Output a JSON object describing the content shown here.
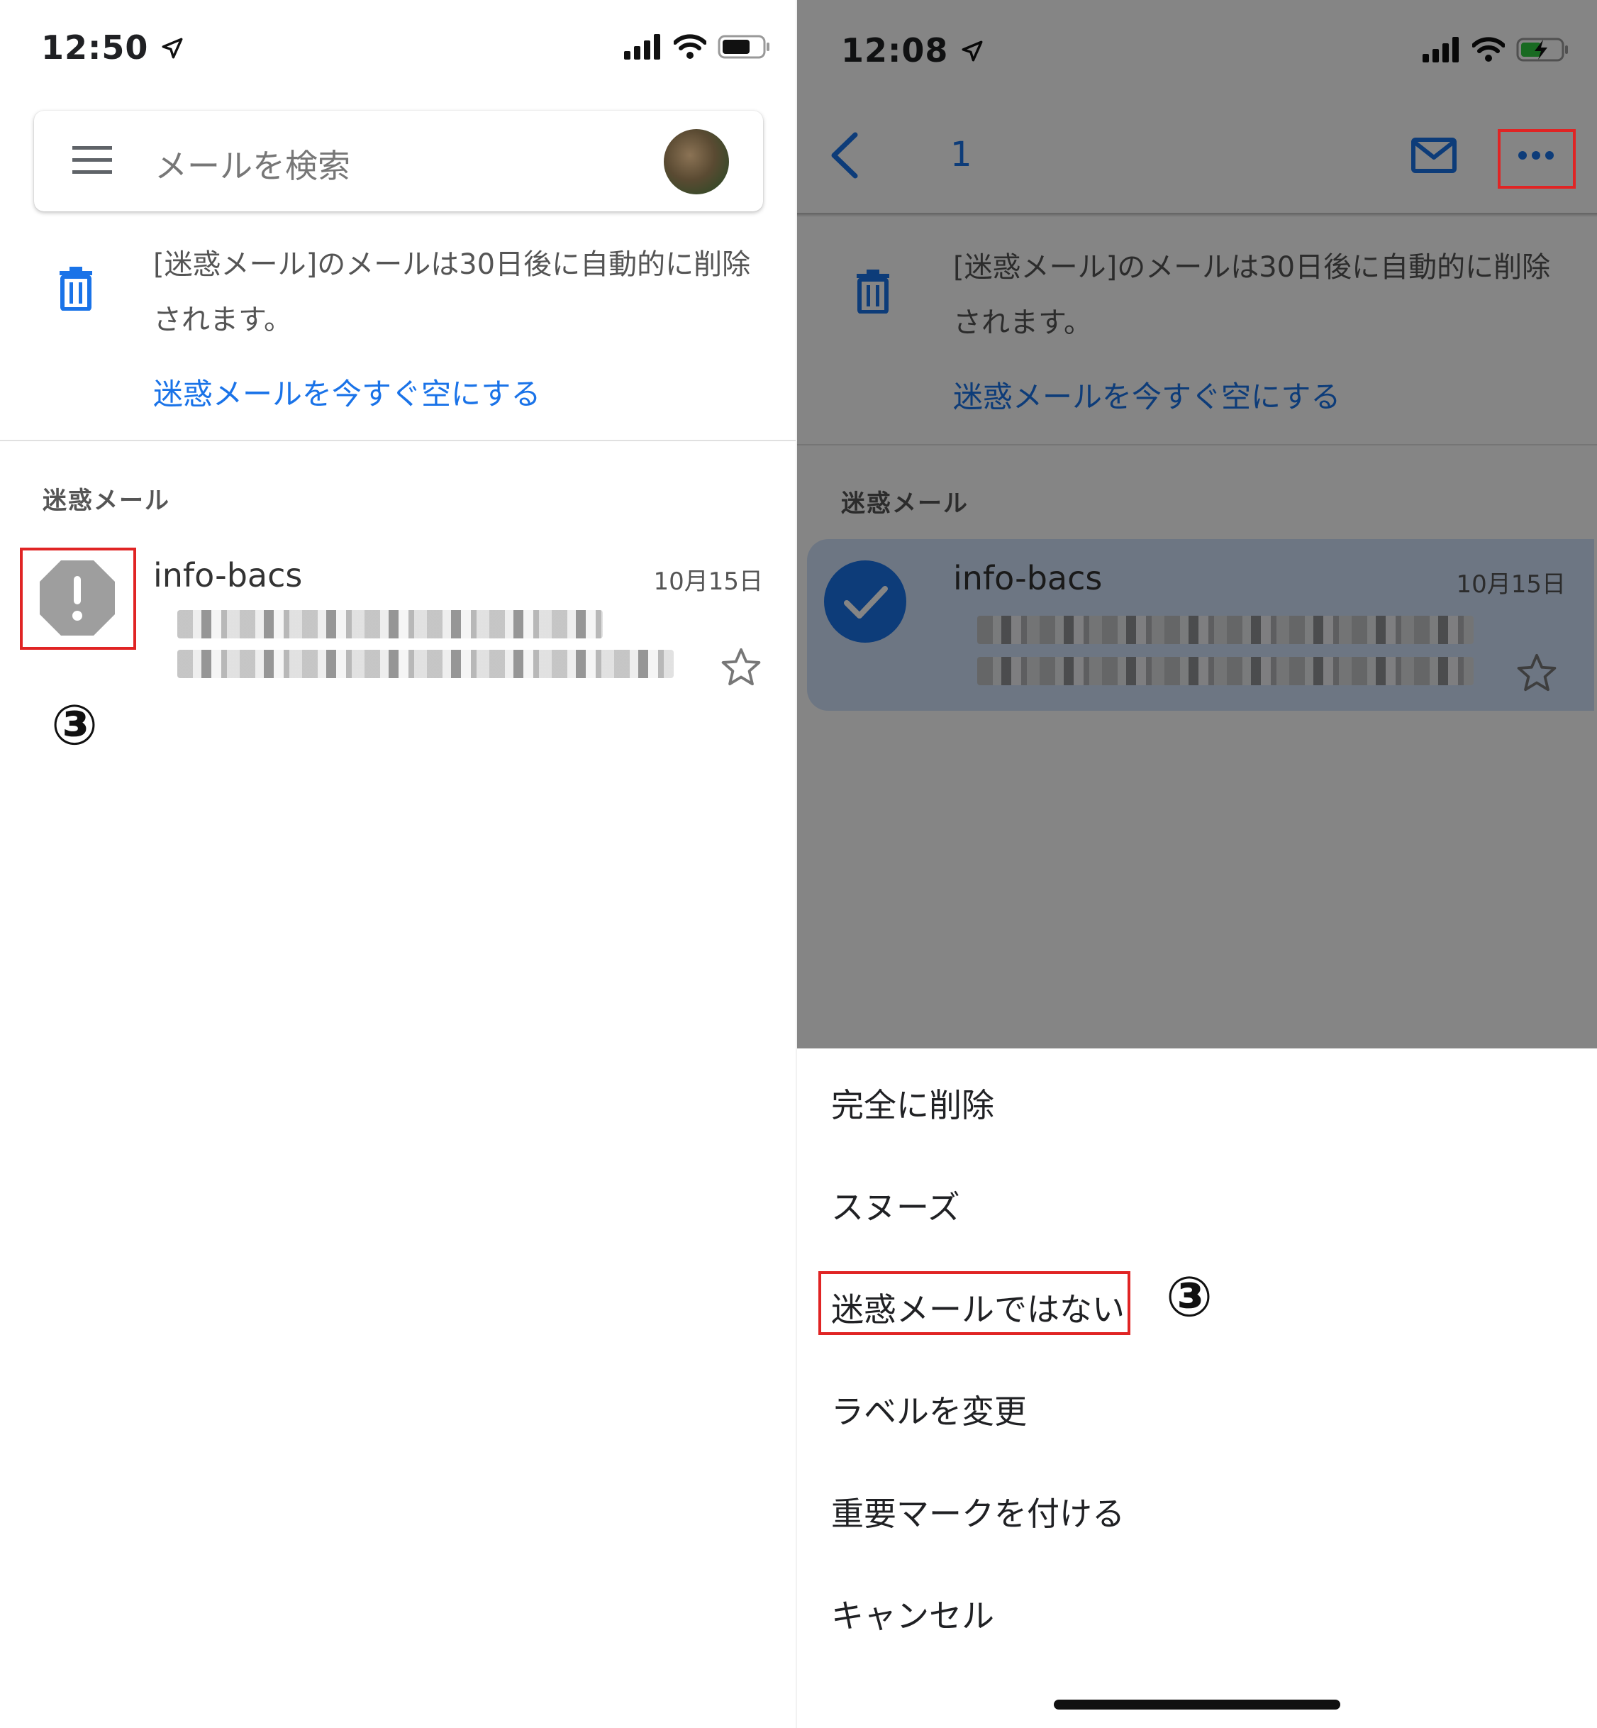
{
  "left": {
    "status_time": "12:50",
    "search_placeholder": "メールを検索",
    "notice_line1": "[迷惑メール]のメールは30日後に自動的に削除",
    "notice_line2": "されます。",
    "notice_link": "迷惑メールを今すぐ空にする",
    "section_label": "迷惑メール",
    "email": {
      "sender": "info-bacs",
      "date": "10月15日"
    },
    "step_marker": "③"
  },
  "right": {
    "status_time": "12:08",
    "selected_count": "1",
    "notice_line1": "[迷惑メール]のメールは30日後に自動的に削除",
    "notice_line2": "されます。",
    "notice_link": "迷惑メールを今すぐ空にする",
    "section_label": "迷惑メール",
    "email": {
      "sender": "info-bacs",
      "date": "10月15日"
    },
    "menu": [
      "完全に削除",
      "スヌーズ",
      "迷惑メールではない",
      "ラベルを変更",
      "重要マークを付ける",
      "キャンセル"
    ],
    "step_marker": "③"
  },
  "colors": {
    "accent": "#1a73e8",
    "highlight": "#e02424",
    "spam_icon": "#9e9e9e"
  }
}
